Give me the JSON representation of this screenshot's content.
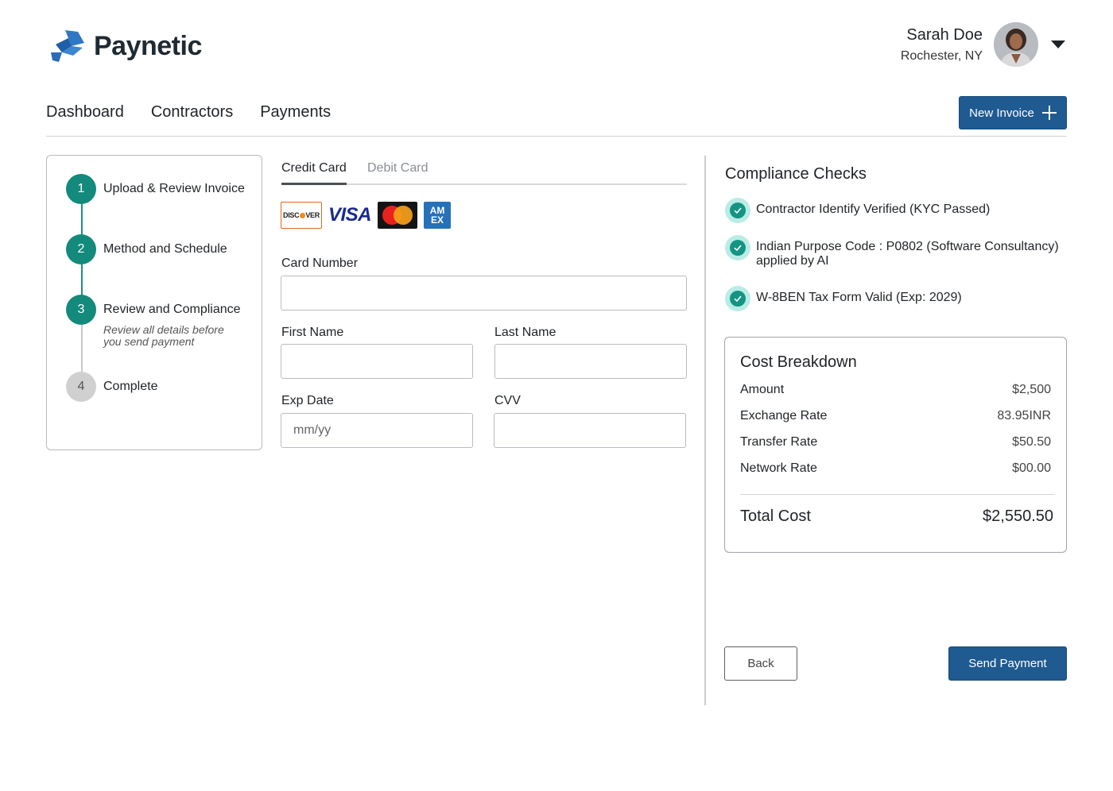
{
  "brand": {
    "name": "Paynetic",
    "color": "#2c6cb5"
  },
  "user": {
    "name": "Sarah Doe",
    "location": "Rochester, NY"
  },
  "nav": {
    "items": [
      "Dashboard",
      "Contractors",
      "Payments"
    ],
    "new_invoice_label": "New Invoice"
  },
  "stepper": {
    "steps": [
      {
        "number": "1",
        "label": "Upload & Review Invoice",
        "state": "done"
      },
      {
        "number": "2",
        "label": "Method and Schedule",
        "state": "done"
      },
      {
        "number": "3",
        "label": "Review and Compliance",
        "state": "current",
        "subtitle": "Review all details before you send payment"
      },
      {
        "number": "4",
        "label": "Complete",
        "state": "pending"
      }
    ]
  },
  "payment_form": {
    "tabs": [
      "Credit Card",
      "Debit Card"
    ],
    "active_tab": "Credit Card",
    "card_brands": [
      "DISCOVER",
      "VISA",
      "Mastercard",
      "AM EX"
    ],
    "card_number": {
      "label": "Card Number",
      "value": ""
    },
    "first_name": {
      "label": "First Name",
      "value": ""
    },
    "last_name": {
      "label": "Last Name",
      "value": ""
    },
    "exp_date": {
      "label": "Exp Date",
      "placeholder": "mm/yy"
    },
    "cvv": {
      "label": "CVV",
      "value": ""
    }
  },
  "compliance": {
    "title": "Compliance Checks",
    "checks": [
      "Contractor Identify Verified (KYC Passed)",
      "Indian Purpose Code : P0802 (Software Consultancy) applied by AI",
      "W-8BEN Tax Form Valid (Exp: 2029)"
    ]
  },
  "cost_breakdown": {
    "title": "Cost Breakdown",
    "rows": [
      {
        "label": "Amount",
        "value": "$2,500"
      },
      {
        "label": "Exchange Rate",
        "value": "83.95INR"
      },
      {
        "label": "Transfer Rate",
        "value": "$50.50"
      },
      {
        "label": "Network Rate",
        "value": "$00.00"
      }
    ],
    "total_label": "Total Cost",
    "total_value": "$2,550.50"
  },
  "actions": {
    "back_label": "Back",
    "send_label": "Send Payment"
  },
  "colors": {
    "accent": "#1f5a91",
    "teal": "#138a7b",
    "check_bg": "#b9ece4"
  }
}
